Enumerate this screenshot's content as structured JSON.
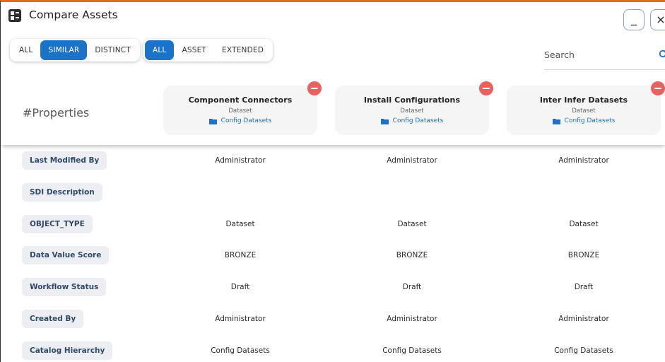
{
  "window": {
    "title": "Compare Assets",
    "minimize_label": "_",
    "close_label": "×"
  },
  "filters": {
    "match": [
      {
        "label": "ALL",
        "active": false
      },
      {
        "label": "SIMILAR",
        "active": true
      },
      {
        "label": "DISTINCT",
        "active": false
      }
    ],
    "scope": [
      {
        "label": "ALL",
        "active": true
      },
      {
        "label": "ASSET",
        "active": false
      },
      {
        "label": "EXTENDED",
        "active": false
      }
    ]
  },
  "search": {
    "placeholder": "Search",
    "value": ""
  },
  "header": {
    "properties_title": "#Properties",
    "assets": [
      {
        "name": "Component Connectors",
        "type": "Dataset",
        "path": "Config Datasets"
      },
      {
        "name": "Install Configurations",
        "type": "Dataset",
        "path": "Config Datasets"
      },
      {
        "name": "Inter Infer Datasets",
        "type": "Dataset",
        "path": "Config Datasets"
      }
    ]
  },
  "rows": [
    {
      "property": "Last Modified By",
      "values": [
        "Administrator",
        "Administrator",
        "Administrator"
      ]
    },
    {
      "property": "SDI Description",
      "values": [
        "",
        "",
        ""
      ]
    },
    {
      "property": "OBJECT_TYPE",
      "values": [
        "Dataset",
        "Dataset",
        "Dataset"
      ]
    },
    {
      "property": "Data Value Score",
      "values": [
        "BRONZE",
        "BRONZE",
        "BRONZE"
      ]
    },
    {
      "property": "Workflow Status",
      "values": [
        "Draft",
        "Draft",
        "Draft"
      ]
    },
    {
      "property": "Created By",
      "values": [
        "Administrator",
        "Administrator",
        "Administrator"
      ]
    },
    {
      "property": "Catalog Hierarchy",
      "values": [
        "Config Datasets",
        "Config Datasets",
        "Config Datasets"
      ]
    }
  ],
  "colors": {
    "accent": "#1a73c9",
    "window_border_top": "#e8691d",
    "remove": "#e86060"
  }
}
